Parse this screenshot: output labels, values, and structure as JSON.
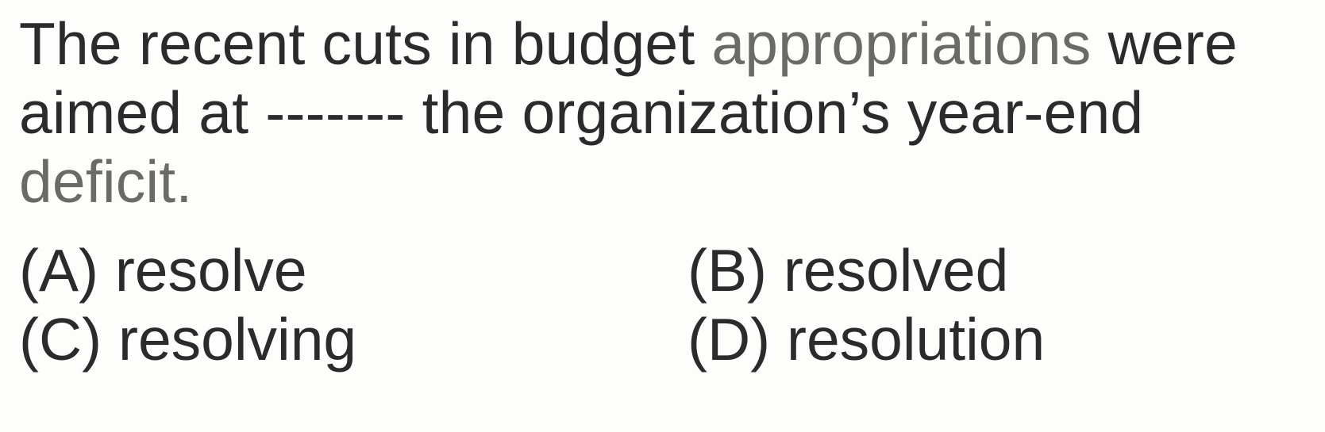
{
  "question": {
    "line1_a": "The recent cuts in budget ",
    "line1_b": "appropriations",
    "line1_c": " were",
    "line2": "aimed at ------- the organization’s year-end",
    "line3": "deficit."
  },
  "options": [
    {
      "letter": "(A)",
      "text": "resolve"
    },
    {
      "letter": "(B)",
      "text": "resolved"
    },
    {
      "letter": "(C)",
      "text": "resolving"
    },
    {
      "letter": "(D)",
      "text": "resolution"
    }
  ]
}
